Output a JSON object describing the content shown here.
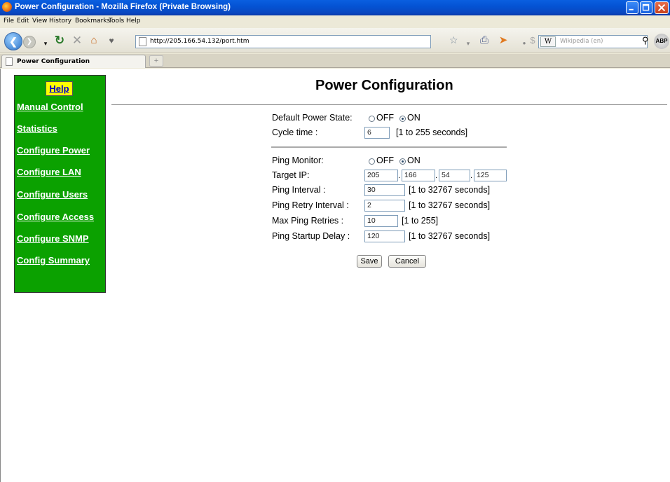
{
  "window": {
    "title": "Power Configuration - Mozilla Firefox (Private Browsing)"
  },
  "menu": [
    "File",
    "Edit",
    "View",
    "History",
    "Bookmarks",
    "Tools",
    "Help"
  ],
  "toolbar": {
    "url": "http://205.166.54.132/port.htm",
    "search_engine_icon": "W",
    "search_placeholder": "Wikipedia (en)",
    "addon_label": "ABP"
  },
  "tabs": [
    {
      "label": "Power Configuration",
      "active": true
    }
  ],
  "sidebar": {
    "help_label": "Help",
    "items": [
      "Manual Control",
      "Statistics",
      "Configure Power",
      "Configure LAN",
      "Configure Users",
      "Configure Access",
      "Configure SNMP",
      "Config Summary"
    ]
  },
  "page": {
    "title": "Power Configuration",
    "default_power_state": {
      "label": "Default Power State:",
      "off": "OFF",
      "on": "ON",
      "selected": "ON"
    },
    "cycle_time": {
      "label": "Cycle time :",
      "value": "6",
      "hint": "[1 to 255 seconds]"
    },
    "ping_monitor": {
      "label": "Ping Monitor:",
      "off": "OFF",
      "on": "ON",
      "selected": "ON"
    },
    "target_ip": {
      "label": "Target IP:",
      "octets": [
        "205",
        "166",
        "54",
        "125"
      ]
    },
    "ping_interval": {
      "label": "Ping Interval :",
      "value": "30",
      "hint": "[1 to 32767 seconds]"
    },
    "ping_retry_interval": {
      "label": "Ping Retry Interval :",
      "value": "2",
      "hint": "[1 to 32767 seconds]"
    },
    "max_ping_retries": {
      "label": "Max Ping Retries :",
      "value": "10",
      "hint": "[1 to 255]"
    },
    "ping_startup_delay": {
      "label": "Ping Startup Delay :",
      "value": "120",
      "hint": "[1 to 32767 seconds]"
    },
    "save_label": "Save",
    "cancel_label": "Cancel"
  }
}
